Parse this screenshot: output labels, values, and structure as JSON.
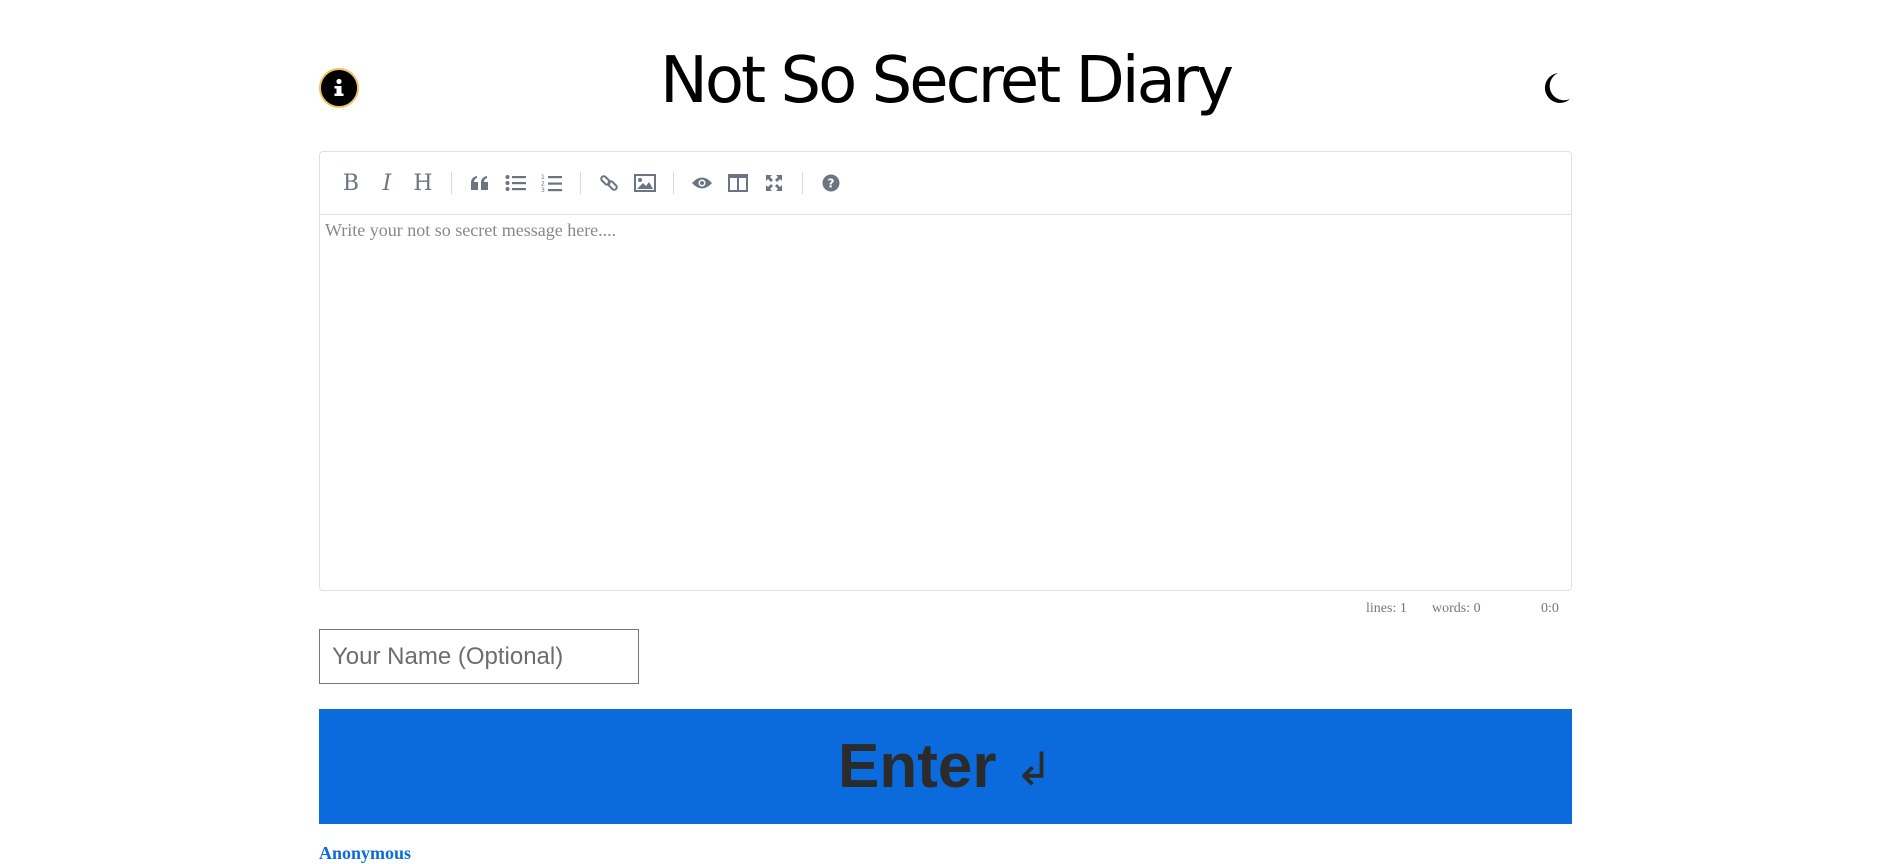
{
  "header": {
    "title": "Not So Secret Diary",
    "info_icon": "info-icon",
    "theme_icon": "moon-icon"
  },
  "toolbar": {
    "buttons": [
      {
        "name": "bold",
        "icon": "bold-icon",
        "glyph": "B"
      },
      {
        "name": "italic",
        "icon": "italic-icon",
        "glyph": "I"
      },
      {
        "name": "heading",
        "icon": "heading-icon",
        "glyph": "H"
      },
      {
        "name": "quote",
        "icon": "quote-icon"
      },
      {
        "name": "unordered-list",
        "icon": "bullet-list-icon"
      },
      {
        "name": "ordered-list",
        "icon": "numbered-list-icon"
      },
      {
        "name": "link",
        "icon": "link-icon"
      },
      {
        "name": "image",
        "icon": "image-icon"
      },
      {
        "name": "preview",
        "icon": "eye-icon"
      },
      {
        "name": "side-by-side",
        "icon": "columns-icon"
      },
      {
        "name": "fullscreen",
        "icon": "fullscreen-icon"
      },
      {
        "name": "guide",
        "icon": "help-icon"
      }
    ]
  },
  "editor": {
    "placeholder": "Write your not so secret message here...."
  },
  "statusbar": {
    "lines": "lines: 1",
    "words": "words: 0",
    "cursor": "0:0"
  },
  "name_input": {
    "placeholder": "Your Name (Optional)",
    "value": ""
  },
  "submit": {
    "label": "Enter",
    "arrow": "↲"
  },
  "entries": [
    {
      "author": "Anonymous"
    }
  ],
  "colors": {
    "accent": "#0b6bdc",
    "toolbar_icon": "#6b7480"
  }
}
